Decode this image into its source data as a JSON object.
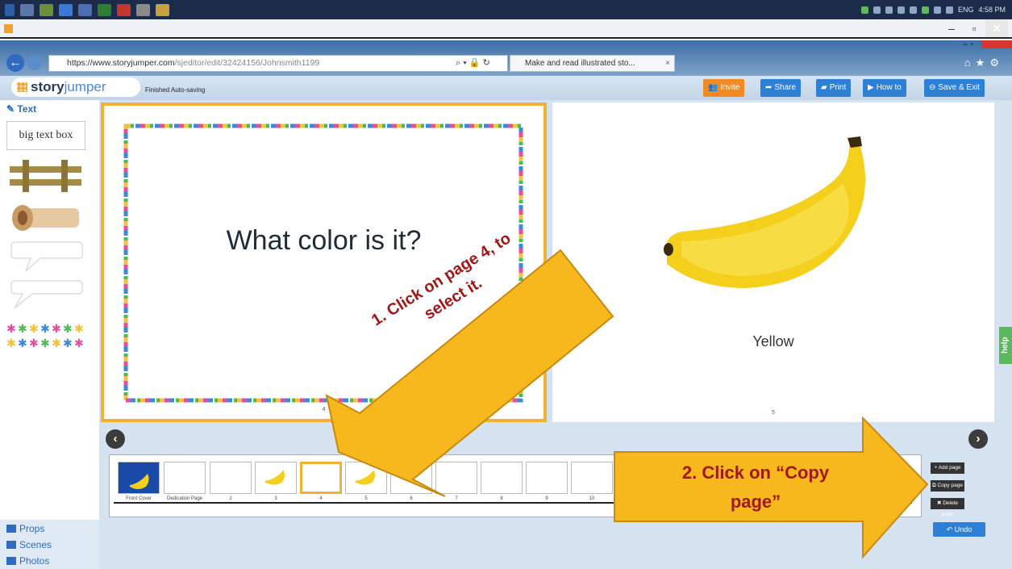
{
  "browser": {
    "url_prefix": "https://",
    "url_domain": "www.storyjumper.com",
    "url_path": "/sjeditor/edit/32424156/Johnsmith1199",
    "tab_title": "Make and read illustrated sto...",
    "tab_close": "×",
    "address_controls": "⌕ ▾ 🔒 ↻"
  },
  "app": {
    "logo_story": "story",
    "logo_jumper": "jumper",
    "autosave_status": "Finished Auto-saving",
    "buttons": {
      "invite": "Invite",
      "share": "Share",
      "print": "Print",
      "howto": "How to",
      "save_exit": "Save & Exit"
    }
  },
  "palette": {
    "title": "Text",
    "textbox_sample": "big text box",
    "bottom_items": [
      "Props",
      "Scenes",
      "Photos"
    ]
  },
  "pages": {
    "left": {
      "title": "What color is it?",
      "number": "4"
    },
    "right": {
      "caption": "Yellow",
      "number": "5"
    }
  },
  "help_tab": "help",
  "thumbnails": {
    "labels": [
      "Front Cover",
      "Dedication Page",
      "2",
      "3",
      "4",
      "5",
      "6",
      "7",
      "8",
      "9",
      "10"
    ],
    "selected_index": 4
  },
  "side_buttons": {
    "add_page": "+ Add page",
    "copy_page": "⧉ Copy page",
    "delete_page": "✖ Delete page",
    "undo": "↶ Undo"
  },
  "callouts": {
    "step1_line1": "1. Click on page 4, to",
    "step1_line2": "select it.",
    "step2_line1": "2. Click on “Copy",
    "step2_line2": "page”"
  },
  "colors": {
    "callout_fill": "#f6b81c",
    "callout_text": "#a01818",
    "accent_blue": "#2e7fd6",
    "selection_border": "#f0b234"
  }
}
